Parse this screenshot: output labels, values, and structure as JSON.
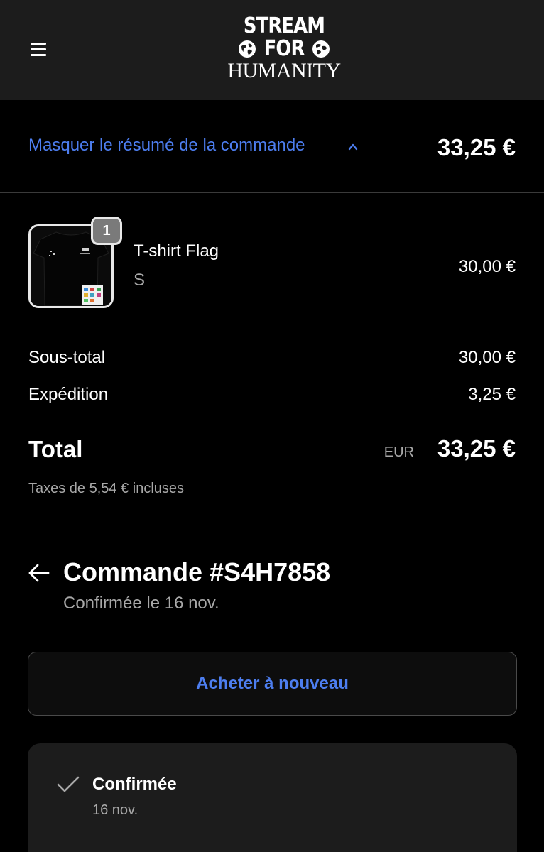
{
  "header": {
    "logo_line1": "STREAM",
    "logo_line2": "FOR",
    "logo_line3": "HUMANITY",
    "menu_icon": "hamburger-menu-icon"
  },
  "summary": {
    "toggle_label": "Masquer le résumé de la commande",
    "toggle_icon": "chevron-up-icon",
    "total": "33,25 €",
    "accent_color": "#4d7ef0"
  },
  "product": {
    "quantity": "1",
    "name": "T-shirt Flag",
    "variant": "S",
    "price": "30,00 €"
  },
  "costs": {
    "subtotal_label": "Sous-total",
    "subtotal_value": "30,00 €",
    "shipping_label": "Expédition",
    "shipping_value": "3,25 €",
    "total_label": "Total",
    "total_currency": "EUR",
    "total_value": "33,25 €",
    "taxes_note": "Taxes de 5,54 € incluses"
  },
  "order": {
    "title": "Commande #S4H7858",
    "subtitle": "Confirmée le 16 nov.",
    "buy_again_label": "Acheter à nouveau"
  },
  "status": {
    "title": "Confirmée",
    "date": "16 nov."
  }
}
